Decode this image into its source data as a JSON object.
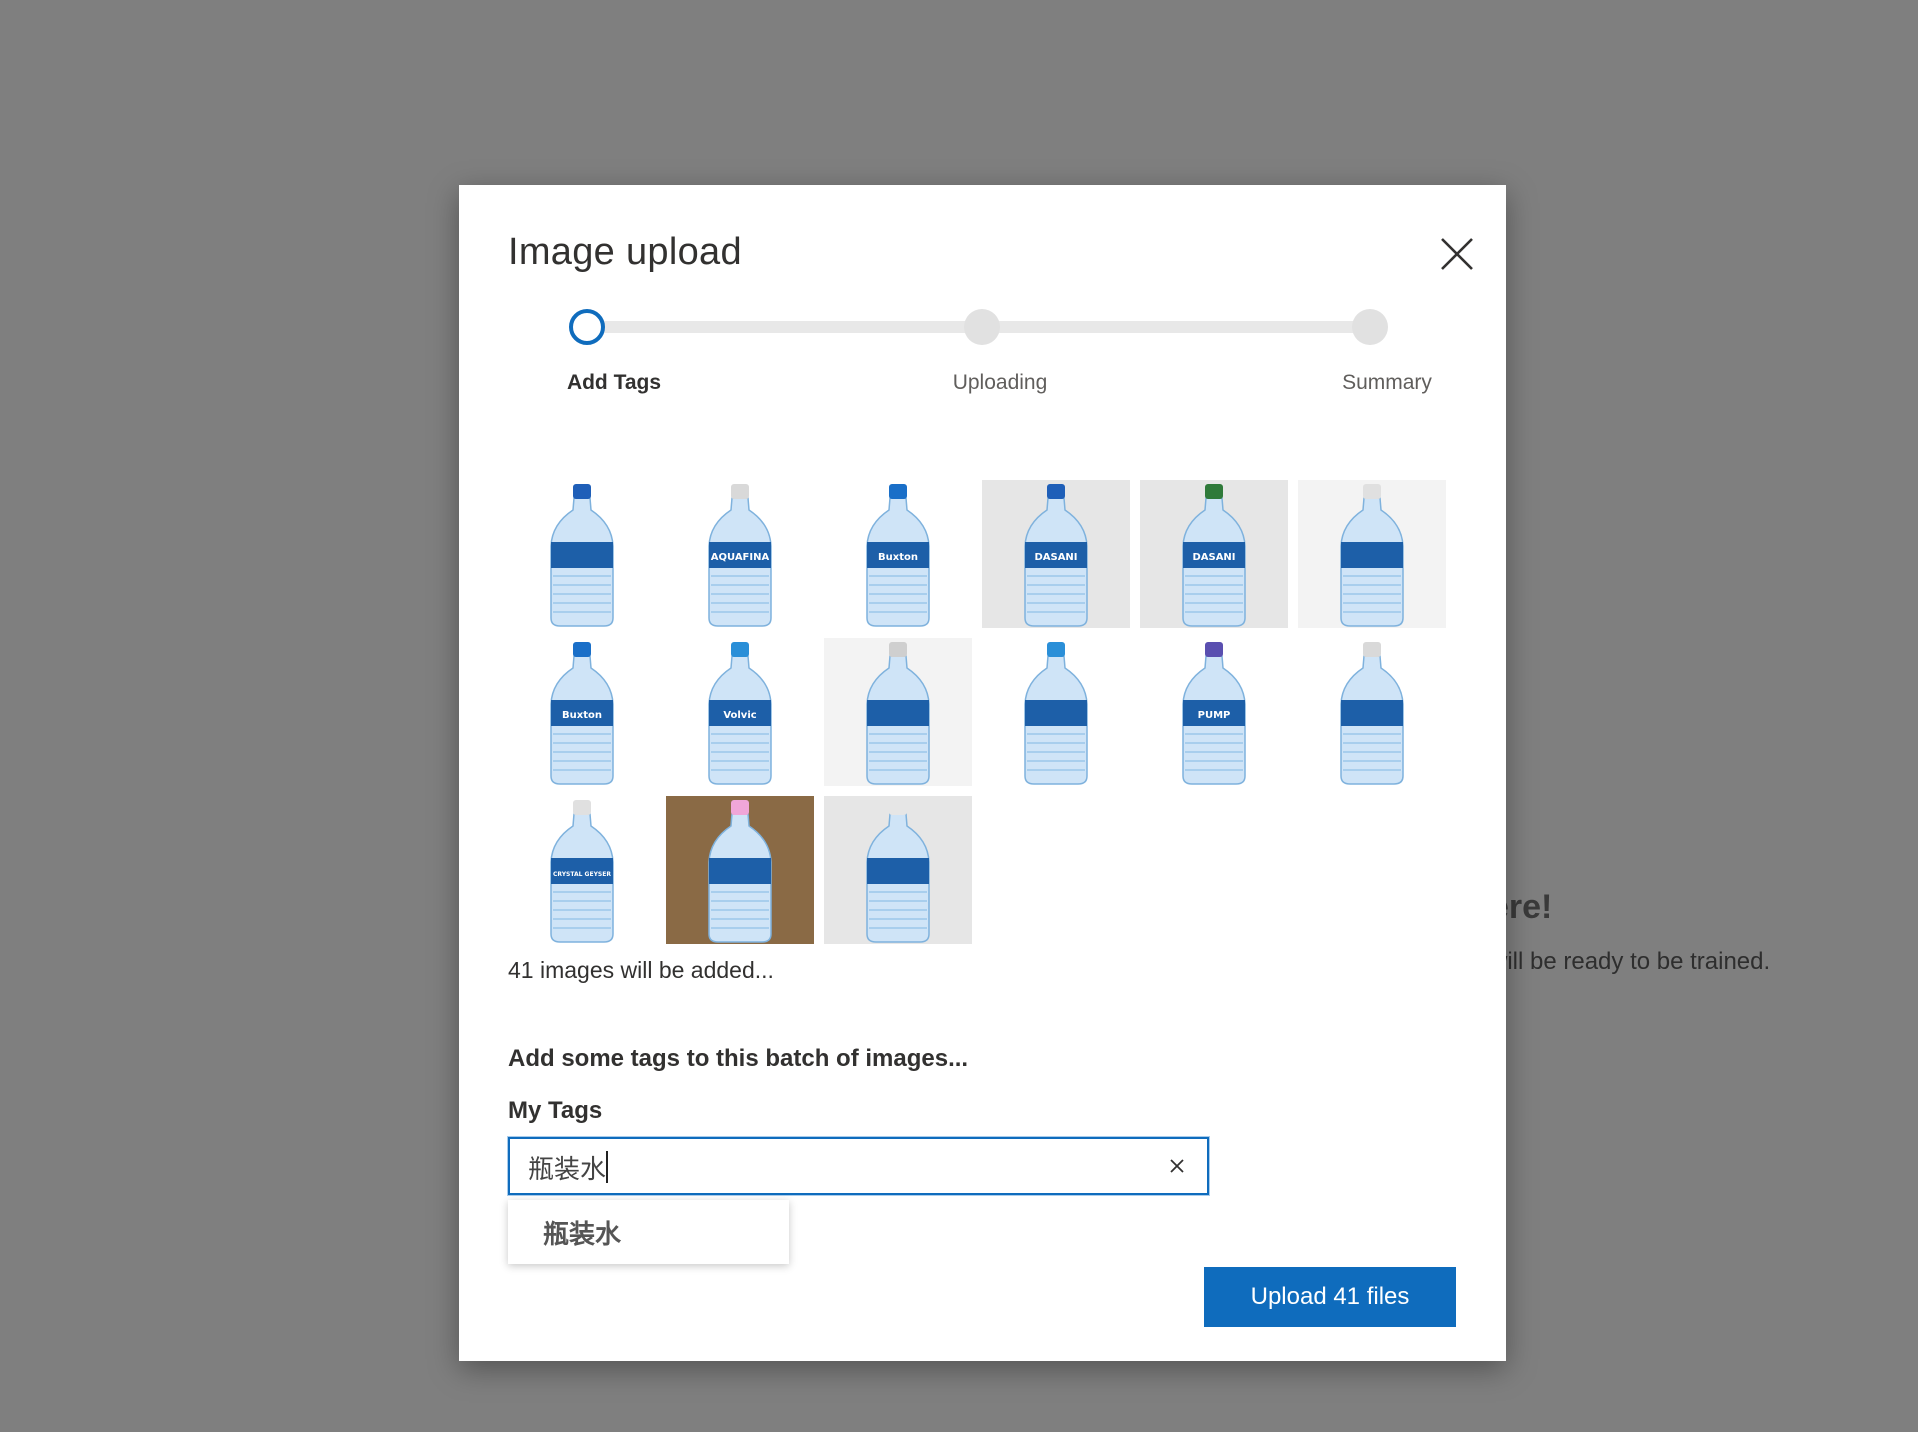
{
  "background": {
    "heading_fragment": "ere!",
    "sub_fragment": "will be ready to be trained."
  },
  "dialog": {
    "title": "Image upload",
    "close_icon": "close-icon"
  },
  "stepper": {
    "steps": [
      {
        "label": "Add Tags",
        "state": "active"
      },
      {
        "label": "Uploading",
        "state": "pending"
      },
      {
        "label": "Summary",
        "state": "pending"
      }
    ]
  },
  "thumbnails": {
    "shown_count": 15,
    "items": [
      {
        "bg": "white",
        "cap": "#1f5fb8",
        "label": ""
      },
      {
        "bg": "white",
        "cap": "#d9d9d9",
        "label": "AQUAFINA"
      },
      {
        "bg": "white",
        "cap": "#1a6fc8",
        "label": "Buxton"
      },
      {
        "bg": "gray",
        "cap": "#1f5fb8",
        "label": "DASANI"
      },
      {
        "bg": "gray",
        "cap": "#2f7a3a",
        "label": "DASANI"
      },
      {
        "bg": "light",
        "cap": "#e0e0e0",
        "label": ""
      },
      {
        "bg": "white",
        "cap": "#1a6fc8",
        "label": "Buxton"
      },
      {
        "bg": "white",
        "cap": "#2a8fd8",
        "label": "Volvic"
      },
      {
        "bg": "light",
        "cap": "#cfcfcf",
        "label": ""
      },
      {
        "bg": "white",
        "cap": "#2a8fd8",
        "label": ""
      },
      {
        "bg": "white",
        "cap": "#5a4fb0",
        "label": "PUMP"
      },
      {
        "bg": "white",
        "cap": "#d9d9d9",
        "label": ""
      },
      {
        "bg": "white",
        "cap": "#e0e0e0",
        "label": "CRYSTAL GEYSER"
      },
      {
        "bg": "brown",
        "cap": "#f0a6d8",
        "label": ""
      },
      {
        "bg": "gray",
        "cap": "#e6e6e6",
        "label": ""
      }
    ]
  },
  "count_text": "41 images will be added...",
  "tags": {
    "heading": "Add some tags to this batch of images...",
    "label": "My Tags",
    "input_value": "瓶装水",
    "clear_icon": "clear-icon",
    "suggestions": [
      "瓶装水"
    ]
  },
  "actions": {
    "upload_label": "Upload 41 files"
  },
  "colors": {
    "accent": "#0f6cbd",
    "overlay": "#7f7f7f"
  }
}
